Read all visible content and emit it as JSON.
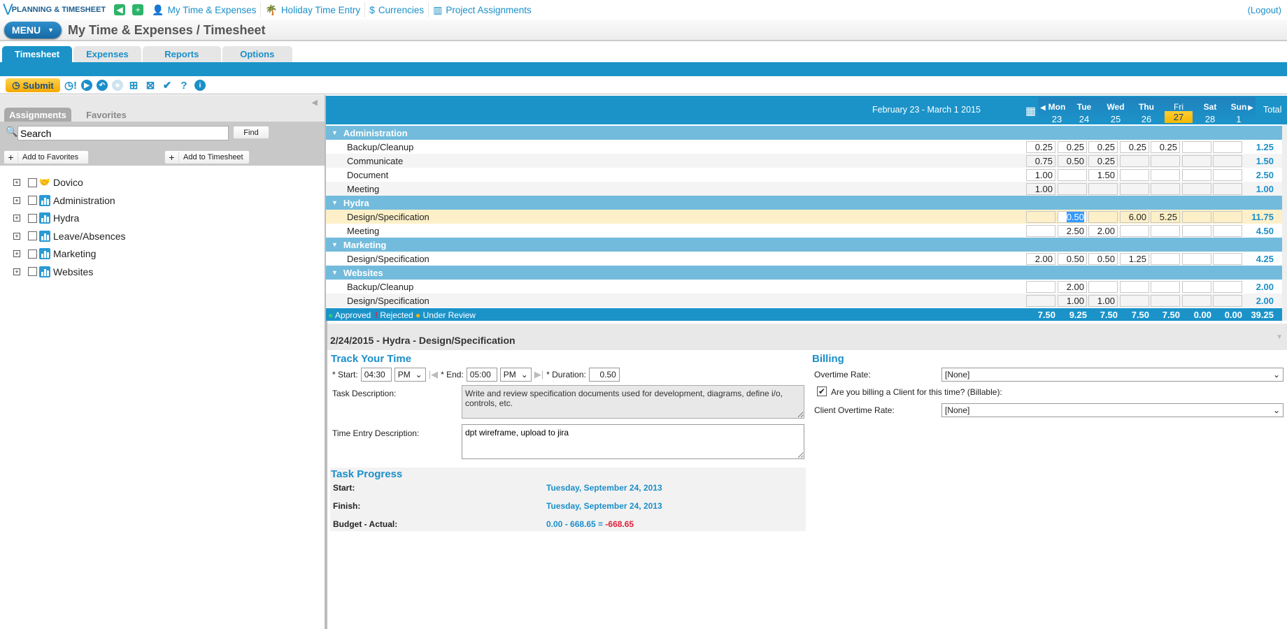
{
  "topnav": {
    "logo": "PLANNING & TIMESHEET",
    "links": [
      "My Time & Expenses",
      "Holiday Time Entry",
      "Currencies",
      "Project Assignments"
    ],
    "logout": "(Logout)"
  },
  "titlebar": {
    "menu": "MENU",
    "title": "My Time & Expenses / Timesheet"
  },
  "tabs": [
    "Timesheet",
    "Expenses",
    "Reports",
    "Options"
  ],
  "toolbar": {
    "submit": "Submit"
  },
  "left": {
    "tabs": [
      "Assignments",
      "Favorites"
    ],
    "search_value": "Search",
    "find": "Find",
    "add_favorites": "Add to Favorites",
    "add_timesheet": "Add to Timesheet",
    "tree": [
      "Dovico",
      "Administration",
      "Hydra",
      "Leave/Absences",
      "Marketing",
      "Websites"
    ]
  },
  "grid": {
    "date_range": "February 23 - March 1 2015",
    "days": [
      {
        "name": "Mon",
        "num": "23"
      },
      {
        "name": "Tue",
        "num": "24"
      },
      {
        "name": "Wed",
        "num": "25"
      },
      {
        "name": "Thu",
        "num": "26"
      },
      {
        "name": "Fri",
        "num": "27"
      },
      {
        "name": "Sat",
        "num": "28"
      },
      {
        "name": "Sun",
        "num": "1"
      }
    ],
    "total_label": "Total",
    "rows": [
      {
        "type": "cat",
        "label": "Administration"
      },
      {
        "type": "item",
        "label": "Backup/Cleanup",
        "cells": [
          "0.25",
          "0.25",
          "0.25",
          "0.25",
          "0.25",
          "",
          ""
        ],
        "total": "1.25"
      },
      {
        "type": "item",
        "label": "Communicate",
        "cells": [
          "0.75",
          "0.50",
          "0.25",
          "",
          "",
          "",
          ""
        ],
        "total": "1.50"
      },
      {
        "type": "item",
        "label": "Document",
        "cells": [
          "1.00",
          "",
          "1.50",
          "",
          "",
          "",
          ""
        ],
        "total": "2.50"
      },
      {
        "type": "item",
        "label": "Meeting",
        "cells": [
          "1.00",
          "",
          "",
          "",
          "",
          "",
          ""
        ],
        "total": "1.00"
      },
      {
        "type": "cat",
        "label": "Hydra"
      },
      {
        "type": "item",
        "label": "Design/Specification",
        "cells": [
          "",
          "0.50",
          "",
          "6.00",
          "5.25",
          "",
          ""
        ],
        "total": "11.75",
        "selected": true
      },
      {
        "type": "item",
        "label": "Meeting",
        "cells": [
          "",
          "2.50",
          "2.00",
          "",
          "",
          "",
          ""
        ],
        "total": "4.50"
      },
      {
        "type": "cat",
        "label": "Marketing"
      },
      {
        "type": "item",
        "label": "Design/Specification",
        "cells": [
          "2.00",
          "0.50",
          "0.50",
          "1.25",
          "",
          "",
          ""
        ],
        "total": "4.25"
      },
      {
        "type": "cat",
        "label": "Websites"
      },
      {
        "type": "item",
        "label": "Backup/Cleanup",
        "cells": [
          "",
          "2.00",
          "",
          "",
          "",
          "",
          ""
        ],
        "total": "2.00"
      },
      {
        "type": "item",
        "label": "Design/Specification",
        "cells": [
          "",
          "1.00",
          "1.00",
          "",
          "",
          "",
          ""
        ],
        "total": "2.00"
      }
    ],
    "legend": [
      "Approved",
      "Rejected",
      "Under Review"
    ],
    "day_totals": [
      "7.50",
      "9.25",
      "7.50",
      "7.50",
      "7.50",
      "0.00",
      "0.00"
    ],
    "grand_total": "39.25"
  },
  "detail": {
    "title": "2/24/2015 - Hydra - Design/Specification",
    "track_title": "Track Your Time",
    "start_label": "* Start:",
    "start": "04:30",
    "start_ampm": "PM",
    "end_label": "* End:",
    "end": "05:00",
    "end_ampm": "PM",
    "duration_label": "* Duration:",
    "duration": "0.50",
    "task_desc_label": "Task Description:",
    "task_desc": "Write and review specification documents used for development, diagrams, define i/o, controls, etc.",
    "entry_desc_label": "Time Entry Description:",
    "entry_desc": "dpt wireframe, upload to jira",
    "progress_title": "Task Progress",
    "start_date_label": "Start:",
    "start_date": "Tuesday, September 24, 2013",
    "finish_label": "Finish:",
    "finish_date": "Tuesday, September 24, 2013",
    "budget_label": "Budget - Actual:",
    "budget_expr": "0.00 - 668.65 = ",
    "budget_result": "-668.65",
    "billing_title": "Billing",
    "overtime_label": "Overtime Rate:",
    "overtime_value": "[None]",
    "billable_label": "Are you billing a Client for this time? (Billable):",
    "client_overtime_label": "Client Overtime Rate:",
    "client_overtime_value": "[None]"
  },
  "colors": {
    "accent": "#1b93c9",
    "category": "#72bbdc",
    "selected_row": "#fdf0c8",
    "today": "#f5b800",
    "negative": "#e0203a"
  }
}
